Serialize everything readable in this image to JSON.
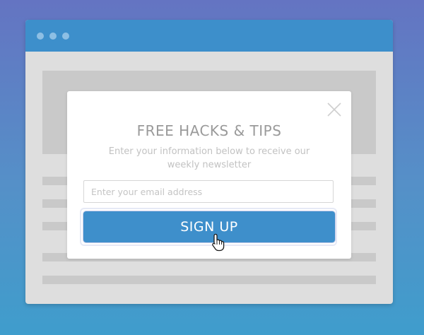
{
  "window": {
    "titlebar_dots": [
      "window-dot",
      "window-dot",
      "window-dot"
    ]
  },
  "modal": {
    "title": "FREE HACKS & TIPS",
    "subtitle": "Enter your information below to receive our weekly newsletter",
    "email_placeholder": "Enter your email address",
    "email_value": "",
    "signup_label": "SIGN UP",
    "close_icon": "close-icon",
    "cursor_icon": "hand-pointer-icon"
  },
  "colors": {
    "accent": "#3e8fcb",
    "background_top": "#6474c2",
    "background_bottom": "#3f9dcc",
    "placeholder_block": "#c9c9c9"
  }
}
